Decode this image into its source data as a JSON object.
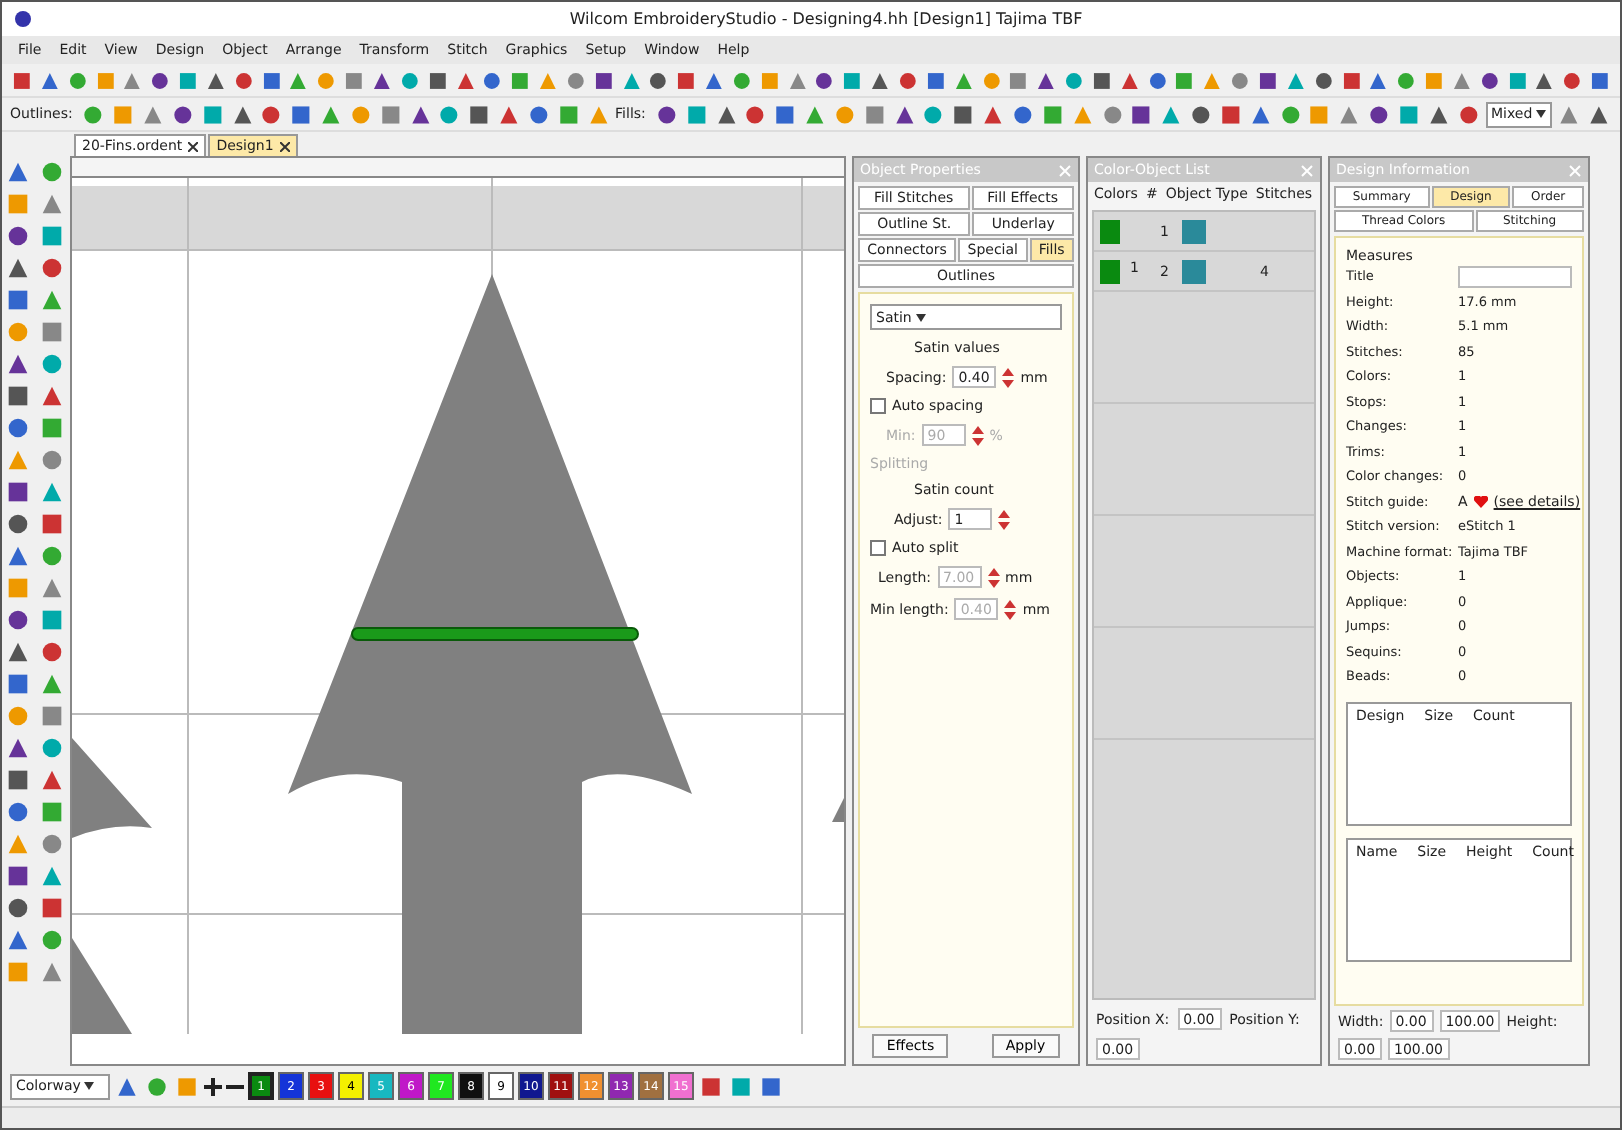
{
  "window": {
    "title": "Wilcom EmbroideryStudio - Designing4.hh   [Design1]   Tajima TBF"
  },
  "menu": [
    "File",
    "Edit",
    "View",
    "Design",
    "Object",
    "Arrange",
    "Transform",
    "Stitch",
    "Graphics",
    "Setup",
    "Window",
    "Help"
  ],
  "toolbar": {
    "outlines_label": "Outlines:",
    "fills_label": "Fills:",
    "style_dropdown": "Mixed"
  },
  "documents": [
    {
      "label": "20-Fins.ordent",
      "selected": false
    },
    {
      "label": "Design1",
      "selected": true
    }
  ],
  "object_properties": {
    "title": "Object Properties",
    "tabs": [
      {
        "label": "Fill Stitches",
        "selected": false
      },
      {
        "label": "Fill Effects",
        "selected": false
      },
      {
        "label": "Outline St.",
        "selected": false
      },
      {
        "label": "Underlay",
        "selected": false
      },
      {
        "label": "Connectors",
        "selected": false
      },
      {
        "label": "Special",
        "selected": false
      },
      {
        "label": "Fills",
        "selected": true
      },
      {
        "label": "Outlines",
        "selected": false
      }
    ],
    "stitch_type": "Satin",
    "satin_heading": "Satin values",
    "spacing_label": "Spacing:",
    "spacing_value": "0.40",
    "spacing_unit": "mm",
    "auto_spacing": {
      "label": "Auto spacing",
      "checked": false
    },
    "min_label": "Min:",
    "min_value": "90",
    "min_unit": "%",
    "splitting": {
      "label": "Splitting",
      "disabled": true
    },
    "count_heading": "Satin count",
    "adjust_label": "Adjust:",
    "adjust_value": "1",
    "auto_split": {
      "label": "Auto split",
      "checked": false
    },
    "length_label": "Length:",
    "length_value": "7.00",
    "length_unit": "mm",
    "min_length_label": "Min length:",
    "min_length_value": "0.40",
    "min_length_unit": "mm",
    "buttons": [
      "Effects",
      "Apply"
    ]
  },
  "color_object_list": {
    "title": "Color-Object List",
    "columns": [
      "Colors",
      "#",
      "Object Type",
      "Stitches"
    ],
    "rows": [
      {
        "number": "1"
      },
      {
        "swatch": "1",
        "number": "2",
        "stitches": "4"
      }
    ]
  },
  "design_information": {
    "title": "Design Information",
    "tabs": [
      {
        "label": "Summary",
        "selected": false
      },
      {
        "label": "Design",
        "selected": true
      },
      {
        "label": "Order",
        "selected": false
      },
      {
        "label": "Thread Colors",
        "selected": false
      },
      {
        "label": "Stitching",
        "selected": false
      }
    ],
    "section": "Measures",
    "fields": [
      {
        "label": "Title",
        "kind": "input"
      },
      {
        "label": "Height:",
        "value": "17.6 mm",
        "kind": "text"
      },
      {
        "label": "Width:",
        "value": "5.1 mm",
        "kind": "text"
      },
      {
        "label": "Stitches:",
        "value": "85",
        "kind": "text"
      },
      {
        "label": "Colors:",
        "value": "1",
        "kind": "text"
      },
      {
        "label": "Stops:",
        "value": "1",
        "kind": "text"
      },
      {
        "label": "Changes:",
        "value": "1",
        "kind": "text"
      },
      {
        "label": "Trims:",
        "value": "1",
        "kind": "text"
      },
      {
        "label": "Color changes:",
        "value": "0",
        "kind": "text"
      },
      {
        "label": "Stitch guide:",
        "value": "A",
        "kind": "rating",
        "link": "(see details)"
      },
      {
        "label": "Stitch version:",
        "value": "eStitch 1",
        "kind": "text"
      },
      {
        "label": "Machine format:",
        "value": "Tajima TBF",
        "kind": "text"
      },
      {
        "label": "Objects:",
        "value": "1",
        "kind": "text"
      },
      {
        "label": "Applique:",
        "value": "0",
        "kind": "text"
      },
      {
        "label": "Jumps:",
        "value": "0",
        "kind": "text"
      },
      {
        "label": "Sequins:",
        "value": "0",
        "kind": "text"
      },
      {
        "label": "Beads:",
        "value": "0",
        "kind": "text"
      }
    ],
    "table1_columns": [
      "Design",
      "Size",
      "Count"
    ],
    "table2_columns": [
      "Name",
      "Size",
      "Height",
      "Count"
    ]
  },
  "colorway": {
    "name": "Colorway",
    "swatches": [
      {
        "label": "1",
        "color": "#0a8a10",
        "selected": true
      },
      {
        "label": "2",
        "color": "#1434d8",
        "selected": false
      },
      {
        "label": "3",
        "color": "#e81010",
        "selected": false
      },
      {
        "label": "4",
        "color": "#f4f000",
        "selected": false
      },
      {
        "label": "5",
        "color": "#18b8c0",
        "selected": false
      },
      {
        "label": "6",
        "color": "#c018c8",
        "selected": false
      },
      {
        "label": "7",
        "color": "#20e820",
        "selected": false
      },
      {
        "label": "8",
        "color": "#101010",
        "selected": false
      },
      {
        "label": "9",
        "color": "#ffffff",
        "selected": false
      },
      {
        "label": "10",
        "color": "#101890",
        "selected": false
      },
      {
        "label": "11",
        "color": "#a01010",
        "selected": false
      },
      {
        "label": "12",
        "color": "#f09030",
        "selected": false
      },
      {
        "label": "13",
        "color": "#9028b0",
        "selected": false
      },
      {
        "label": "14",
        "color": "#a07040",
        "selected": false
      },
      {
        "label": "15",
        "color": "#f070d0",
        "selected": false
      }
    ]
  },
  "position": {
    "x_label": "Position X:",
    "x_value": "0.00",
    "y_label": "Position Y:",
    "y_value": "0.00",
    "w_label": "Width:",
    "w_value": "0.00",
    "h_label": "Height:",
    "h_value": "0.00",
    "w_pct": "100.00",
    "h_pct": "100.00"
  }
}
